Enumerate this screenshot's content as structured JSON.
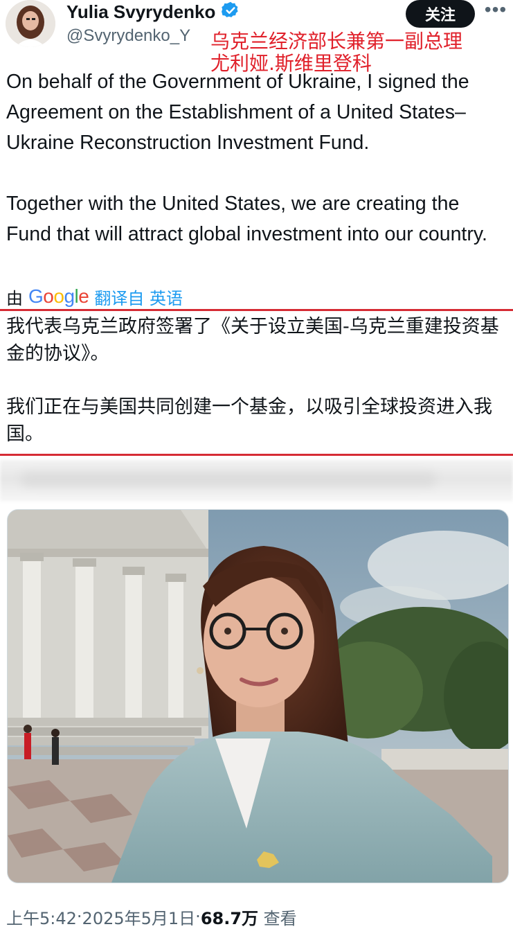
{
  "author": {
    "name": "Yulia Svyrydenko",
    "handle": "@Svyrydenko_Y",
    "verified": true,
    "verified_color": "#1d9bf0"
  },
  "header": {
    "follow_label": "关注",
    "more_icon": "more-horizontal-icon"
  },
  "annotation": {
    "line1": "乌克兰经济部长兼第一副总理",
    "line2": "尤利娅.斯维里登科",
    "color": "#e0202a"
  },
  "tweet": {
    "paragraph1": "On behalf of the Government of Ukraine, I signed the Agreement on the Establishment of a United States–Ukraine Reconstruction Investment Fund.",
    "paragraph2": "Together with the United States, we are creating the Fund that will attract global investment into our country."
  },
  "translation": {
    "by": "由",
    "google": "Google",
    "from": "翻译自 英语",
    "paragraph1": "我代表乌克兰政府签署了《关于设立美国-乌克兰重建投资基金的协议》。",
    "paragraph2": "我们正在与美国共同创建一个基金，以吸引全球投资进入我国。",
    "border_color": "#d62b34"
  },
  "meta": {
    "time": "上午5:42",
    "date": "2025年5月1日",
    "views": "68.7万",
    "views_label": "查看",
    "separator": " · "
  }
}
